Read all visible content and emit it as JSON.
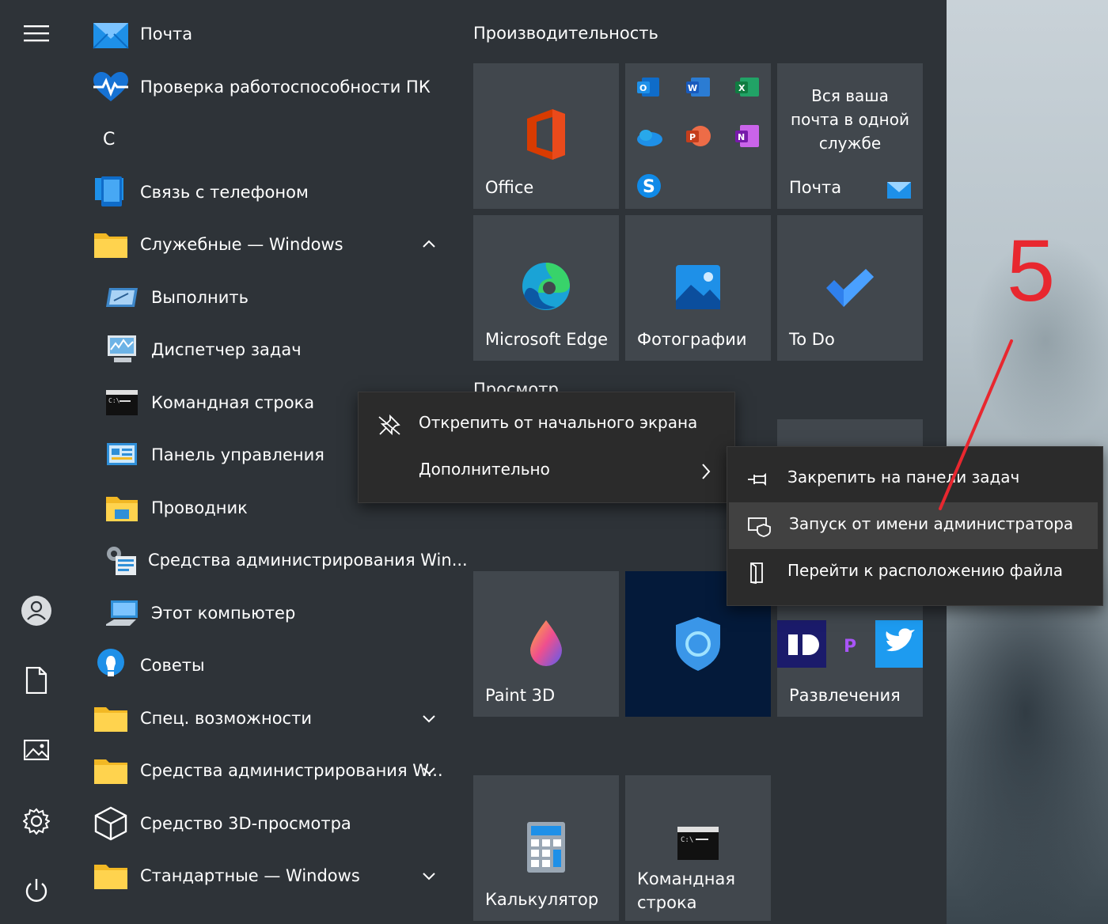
{
  "rail": {
    "items": [
      {
        "name": "hamburger-menu-icon"
      },
      {
        "name": "user-account-icon"
      },
      {
        "name": "documents-icon"
      },
      {
        "name": "pictures-icon"
      },
      {
        "name": "settings-gear-icon"
      },
      {
        "name": "power-icon"
      }
    ]
  },
  "applist": {
    "mail": "Почта",
    "health": "Проверка работоспособности ПК",
    "letter_c": "С",
    "phone": "Связь с телефоном",
    "tools_folder": "Служебные — Windows",
    "run": "Выполнить",
    "taskmgr": "Диспетчер задач",
    "cmd": "Командная строка",
    "control": "Панель управления",
    "explorer": "Проводник",
    "admintools": "Средства администрирования Win...",
    "thispc": "Этот компьютер",
    "tips": "Советы",
    "accessibility": "Спец. возможности",
    "admintools_folder": "Средства администрирования W...",
    "viewer3d": "Средство 3D-просмотра",
    "standard": "Стандартные — Windows"
  },
  "tiles": {
    "group_productivity": "Производительность",
    "group_browse": "Просмотр",
    "office": "Office",
    "mail_promo": "Вся ваша почта в одной службе",
    "mail": "Почта",
    "edge": "Microsoft Edge",
    "photos": "Фотографии",
    "todo": "To Do",
    "paint3d": "Paint 3D",
    "entertainment": "Развлечения",
    "calculator": "Калькулятор",
    "cmd_line1": "Командная",
    "cmd_line2": "строка"
  },
  "context_menu": {
    "unpin": "Открепить от начального экрана",
    "more": "Дополнительно"
  },
  "submenu": {
    "pin_taskbar": "Закрепить на панели задач",
    "run_admin": "Запуск от имени администратора",
    "open_location": "Перейти к расположению файла"
  },
  "annotation": {
    "step": "5",
    "color": "#e8272f"
  },
  "colors": {
    "start_bg": "#2e3338",
    "tile_bg": "#41474d",
    "menu_bg": "#2b2b2b",
    "menu_highlight": "#414141",
    "vpn_tile_bg": "#041a3a"
  }
}
